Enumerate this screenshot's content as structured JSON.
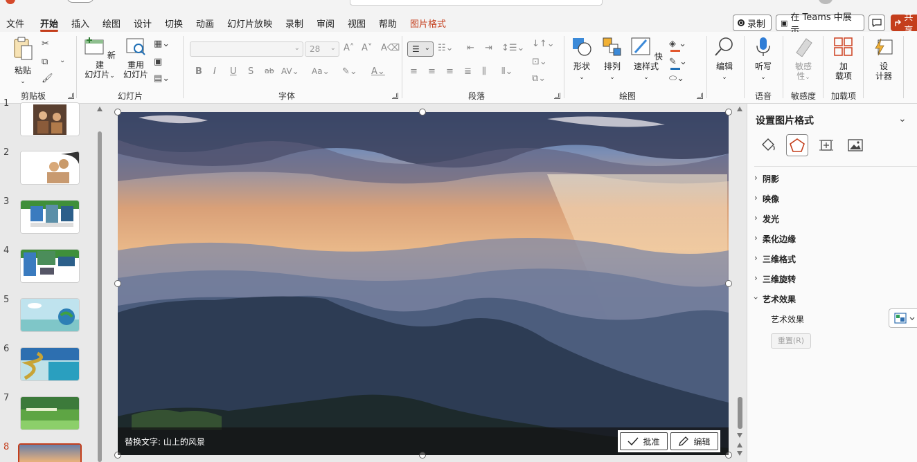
{
  "menu": {
    "tabs": [
      "文件",
      "开始",
      "插入",
      "绘图",
      "设计",
      "切换",
      "动画",
      "幻灯片放映",
      "录制",
      "审阅",
      "视图",
      "帮助",
      "图片格式"
    ],
    "active_tab": "开始",
    "record_label": "录制",
    "teams_label": "在 Teams 中展示",
    "share_label": "共享"
  },
  "ribbon": {
    "clipboard": {
      "paste": "粘贴",
      "group": "剪贴板"
    },
    "slides": {
      "new_slide_line1": "新建",
      "new_slide_line2": "幻灯片",
      "reuse_line1": "重用",
      "reuse_line2": "幻灯片",
      "group": "幻灯片"
    },
    "font": {
      "font_size": "28",
      "group": "字体"
    },
    "paragraph": {
      "group": "段落"
    },
    "drawing": {
      "shapes": "形状",
      "arrange": "排列",
      "quick_styles": "快速样式",
      "group": "绘图"
    },
    "editing": {
      "edit": "编辑"
    },
    "voice": {
      "dictate": "听写",
      "group": "语音"
    },
    "sensitivity": {
      "line1": "敏感",
      "line2": "性",
      "group": "敏感度"
    },
    "addins": {
      "line1": "加",
      "line2": "载项",
      "group": "加载项"
    },
    "designer": {
      "line1": "设",
      "line2": "计器"
    }
  },
  "slides_pane": {
    "numbers": [
      "1",
      "2",
      "3",
      "4",
      "5",
      "6",
      "7",
      "8"
    ],
    "active": "8"
  },
  "canvas": {
    "alt_text": "替换文字: 山上的风景",
    "approve_label": "批准",
    "edit_label": "编辑"
  },
  "format_pane": {
    "title": "设置图片格式",
    "sections": [
      "阴影",
      "映像",
      "发光",
      "柔化边缘",
      "三维格式",
      "三维旋转",
      "艺术效果"
    ],
    "art_effects_label": "艺术效果",
    "reset_label": "重置(R)"
  },
  "colors": {
    "accent": "#c43e1c"
  }
}
